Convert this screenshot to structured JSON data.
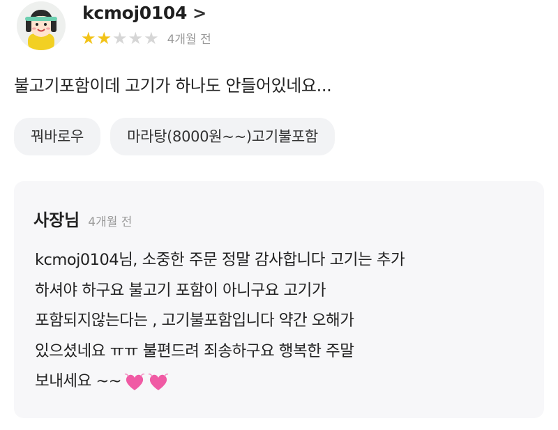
{
  "review": {
    "username": "kcmoj0104",
    "chevron": ">",
    "rating": 2,
    "rating_max": 5,
    "time": "4개월 전",
    "text": "불고기포함이데 고기가 하나도 안들어있네요...",
    "tags": [
      "꿔바로우",
      "마라탕(8000원~~)고기불포함"
    ]
  },
  "reply": {
    "author": "사장님",
    "time": "4개월 전",
    "lines": [
      "kcmoj0104님, 소중한 주문 정말 감사합니다  고기는 추가",
      "하셔야 하구요 불고기 포함이 아니구요 고기가",
      "포함되지않는다는 , 고기불포함입니다 약간 오해가",
      "있으셨네요 ㅠㅠ 불편드려 죄송하구요 행복한 주말",
      "보내세요 ~~"
    ],
    "emoji": [
      "two-hearts-icon",
      "two-hearts-icon"
    ]
  },
  "colors": {
    "star_on": "#f2c318",
    "star_off": "#d6d6d6",
    "tag_bg": "#f2f3f5",
    "reply_bg": "#f7f7f9",
    "heart": "#f05aa4"
  }
}
